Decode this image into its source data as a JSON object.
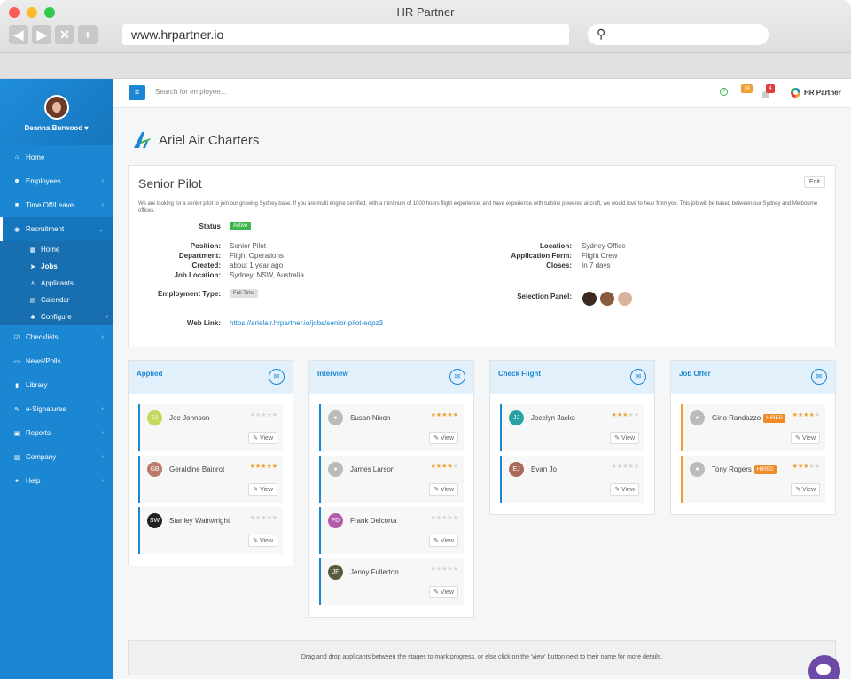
{
  "window": {
    "title": "HR Partner"
  },
  "browser": {
    "url": "www.hrpartner.io",
    "nav_buttons": [
      "◀",
      "▶",
      "✕",
      "+"
    ]
  },
  "sidebar": {
    "user": "Deanna Burwood ▾",
    "items": [
      {
        "icon": "home-icon",
        "label": "Home",
        "chevron": ""
      },
      {
        "icon": "users-icon",
        "label": "Employees",
        "chevron": "‹"
      },
      {
        "icon": "briefcase-icon",
        "label": "Time Off/Leave",
        "chevron": "‹"
      },
      {
        "icon": "eye-icon",
        "label": "Recruitment",
        "chevron": "⌄"
      }
    ],
    "subitems": [
      {
        "icon": "grid-icon",
        "label": "Home"
      },
      {
        "icon": "plane-icon",
        "label": "Jobs"
      },
      {
        "icon": "user-icon",
        "label": "Applicants"
      },
      {
        "icon": "calendar-icon",
        "label": "Calendar"
      },
      {
        "icon": "gear-icon",
        "label": "Configure"
      }
    ],
    "items2": [
      {
        "icon": "checklist-icon",
        "label": "Checklists",
        "chevron": "‹"
      },
      {
        "icon": "news-icon",
        "label": "News/Polls",
        "chevron": ""
      },
      {
        "icon": "book-icon",
        "label": "Library",
        "chevron": ""
      },
      {
        "icon": "pen-icon",
        "label": "e-Signatures",
        "chevron": "‹"
      },
      {
        "icon": "print-icon",
        "label": "Reports",
        "chevron": "‹"
      },
      {
        "icon": "bank-icon",
        "label": "Company",
        "chevron": "‹"
      },
      {
        "icon": "help-icon",
        "label": "Help",
        "chevron": "‹"
      }
    ]
  },
  "topbar": {
    "search_placeholder": "Search for employee...",
    "notif_count_1": "14",
    "notif_count_2": "4",
    "brand": "HR Partner"
  },
  "company": {
    "name": "Ariel Air Charters"
  },
  "job": {
    "title": "Senior Pilot",
    "edit": "Edit",
    "description": "We are looking for a senior pilot to join our growing Sydney base. If you are multi engine certified, with a minimum of 1000 hours flight experience, and have experience with turbine powered aircraft, we would love to hear from you. This job will be based between our Sydney and Melbourne offices.",
    "status_label": "Status",
    "status": "Active",
    "position_label": "Position:",
    "position": "Senior Pilot",
    "department_label": "Department:",
    "department": "Flight Operations",
    "created_label": "Created:",
    "created": "about 1 year ago",
    "job_location_label": "Job Location:",
    "job_location": "Sydney, NSW, Australia",
    "location_label": "Location:",
    "location": "Sydney Office",
    "app_form_label": "Application Form:",
    "app_form": "Flight Crew",
    "closes_label": "Closes:",
    "closes": "In 7 days",
    "emp_type_label": "Employment Type:",
    "emp_type": "Full Time",
    "panel_label": "Selection Panel:",
    "weblink_label": "Web Link:",
    "weblink": "https://arielair.hrpartner.io/jobs/senior-pilot-edpz3"
  },
  "pipeline": [
    {
      "stage": "Applied",
      "cards": [
        {
          "initials": "JJ",
          "name": "Joe Johnson",
          "rating": 0,
          "color": "#c6d85a",
          "hired": ""
        },
        {
          "initials": "GB",
          "name": "Geraldine Bainrot",
          "rating": 5,
          "color": "#b97b68",
          "hired": ""
        },
        {
          "initials": "SW",
          "name": "Stanley Wainwright",
          "rating": 0,
          "color": "#222222",
          "hired": ""
        }
      ]
    },
    {
      "stage": "Interview",
      "cards": [
        {
          "initials": "",
          "name": "Susan Nixon",
          "rating": 5,
          "color": "",
          "hired": ""
        },
        {
          "initials": "",
          "name": "James Larson",
          "rating": 4,
          "color": "",
          "hired": ""
        },
        {
          "initials": "FD",
          "name": "Frank Delcorta",
          "rating": 0,
          "color": "#b45aa8",
          "hired": ""
        },
        {
          "initials": "JF",
          "name": "Jenny Fullerton",
          "rating": 0,
          "color": "#5a5a3c",
          "hired": ""
        }
      ]
    },
    {
      "stage": "Check Flight",
      "cards": [
        {
          "initials": "JJ",
          "name": "Jocelyn Jacks",
          "rating": 3,
          "color": "#2aa2a2",
          "hired": ""
        },
        {
          "initials": "EJ",
          "name": "Evan Jo",
          "rating": 0,
          "color": "#a86a5a",
          "hired": ""
        }
      ]
    },
    {
      "stage": "Job Offer",
      "cards": [
        {
          "initials": "",
          "name": "Gino Randazzo",
          "rating": 4,
          "color": "",
          "hired": "HIRED"
        },
        {
          "initials": "",
          "name": "Tony Rogers",
          "rating": 3,
          "color": "",
          "hired": "HIRED"
        }
      ]
    }
  ],
  "view_label": "View",
  "hint": "Drag and drop applicants between the stages to mark progress, or else click on the 'view' button next to their name for more details."
}
